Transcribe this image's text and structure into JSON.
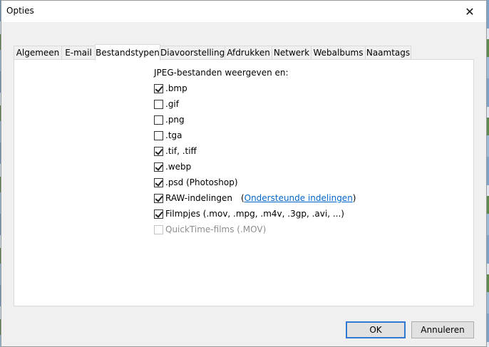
{
  "window": {
    "title": "Opties"
  },
  "tabs": [
    {
      "label": "Algemeen"
    },
    {
      "label": "E-mail"
    },
    {
      "label": "Bestandstypen",
      "active": true
    },
    {
      "label": "Diavoorstelling"
    },
    {
      "label": "Afdrukken"
    },
    {
      "label": "Netwerk"
    },
    {
      "label": "Webalbums"
    },
    {
      "label": "Naamtags"
    }
  ],
  "panel": {
    "heading": "JPEG-bestanden weergeven en:",
    "options": [
      {
        "label": ".bmp",
        "checked": true
      },
      {
        "label": ".gif",
        "checked": false
      },
      {
        "label": ".png",
        "checked": false
      },
      {
        "label": ".tga",
        "checked": false
      },
      {
        "label": ".tif, .tiff",
        "checked": true
      },
      {
        "label": ".webp",
        "checked": true
      },
      {
        "label": ".psd (Photoshop)",
        "checked": true
      },
      {
        "label": "RAW-indelingen",
        "checked": true,
        "link_open": "(",
        "link_text": "Ondersteunde indelingen",
        "link_close": ")"
      },
      {
        "label": "Filmpjes (.mov, .mpg, .m4v, .3gp, .avi, ...)",
        "checked": true
      },
      {
        "label": "QuickTime-films (.MOV)",
        "checked": false,
        "disabled": true
      }
    ]
  },
  "buttons": {
    "ok": "OK",
    "cancel": "Annuleren"
  },
  "colors": {
    "accent": "#3279d3",
    "link": "#0066cc",
    "disabled_text": "#8d8d8d"
  }
}
